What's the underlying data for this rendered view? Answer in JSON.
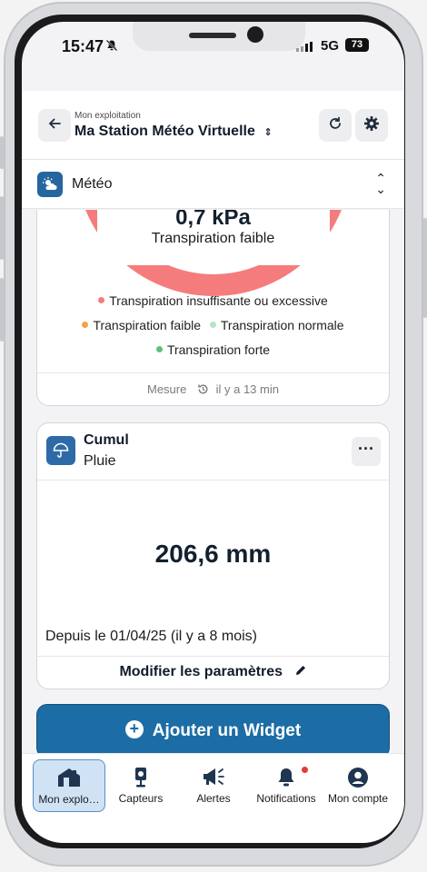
{
  "status_bar": {
    "time": "15:47",
    "network": "5G",
    "battery": "73"
  },
  "header": {
    "subtitle": "Mon exploitation",
    "title": "Ma Station Météo Virtuelle"
  },
  "selector": {
    "label": "Météo"
  },
  "transpiration_card": {
    "value": "0,7 kPa",
    "status": "Transpiration faible",
    "legend": [
      {
        "label": "Transpiration insuffisante ou excessive",
        "color": "#f57c7c"
      },
      {
        "label": "Transpiration faible",
        "color": "#f5a04a"
      },
      {
        "label": "Transpiration normale",
        "color": "#b9e3c8"
      },
      {
        "label": "Transpiration forte",
        "color": "#5fbf7e"
      }
    ],
    "footer_label": "Mesure",
    "footer_time": "il y a 13 min"
  },
  "cumul_card": {
    "title": "Cumul",
    "subtitle": "Pluie",
    "value": "206,6 mm",
    "since": "Depuis le 01/04/25 (il y a 8 mois)",
    "footer": "Modifier les paramètres"
  },
  "add_widget": {
    "label": "Ajouter un Widget"
  },
  "tabs": [
    {
      "label": "Mon explo…",
      "icon": "home-icon"
    },
    {
      "label": "Capteurs",
      "icon": "sensor-icon"
    },
    {
      "label": "Alertes",
      "icon": "megaphone-icon"
    },
    {
      "label": "Notifications",
      "icon": "bell-icon"
    },
    {
      "label": "Mon compte",
      "icon": "account-icon"
    }
  ]
}
